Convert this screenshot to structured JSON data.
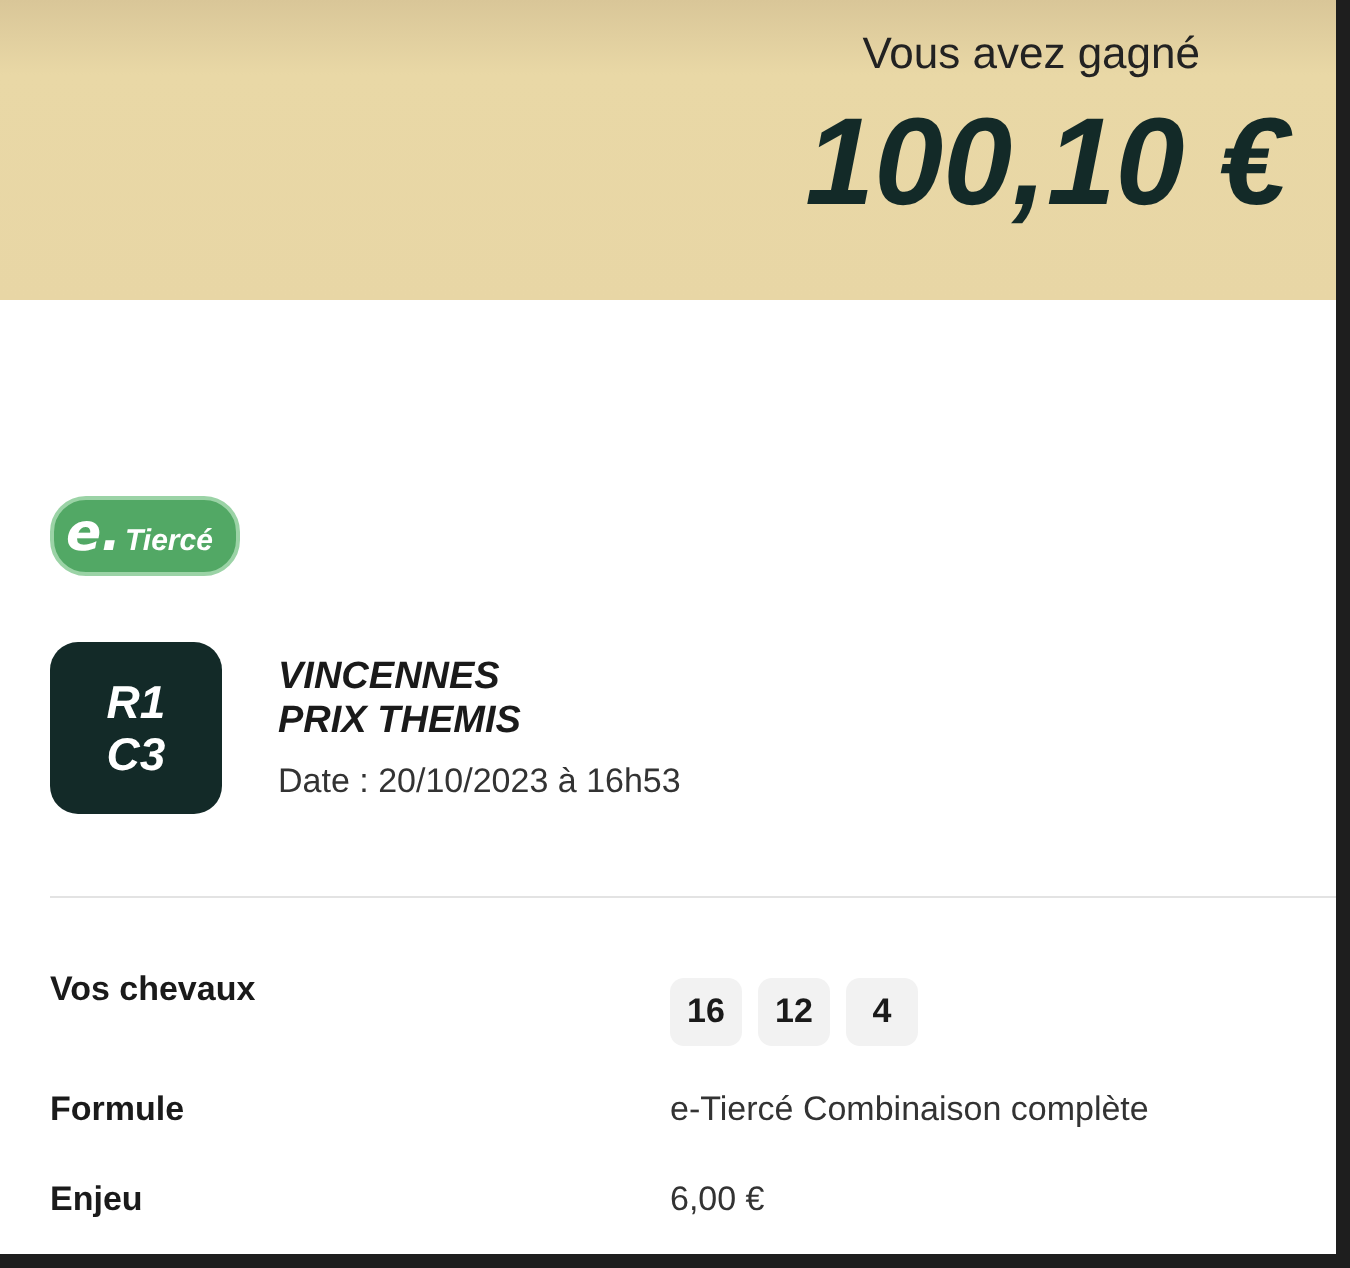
{
  "header": {
    "subtitle": "Vous avez gagné",
    "amount": "100,10 €"
  },
  "bet_badge": {
    "prefix": "e.",
    "label": "Tiercé"
  },
  "race": {
    "reunion": "R1",
    "course": "C3",
    "venue": "VINCENNES",
    "name": "PRIX THEMIS",
    "date": "Date : 20/10/2023 à 16h53"
  },
  "details": [
    {
      "kind": "horses",
      "label": "Vos chevaux",
      "horses": [
        "16",
        "12",
        "4"
      ]
    },
    {
      "kind": "text",
      "label": "Formule",
      "value": "e-Tiercé Combinaison complète"
    },
    {
      "kind": "text",
      "label": "Enjeu",
      "value": "6,00 €"
    }
  ]
}
